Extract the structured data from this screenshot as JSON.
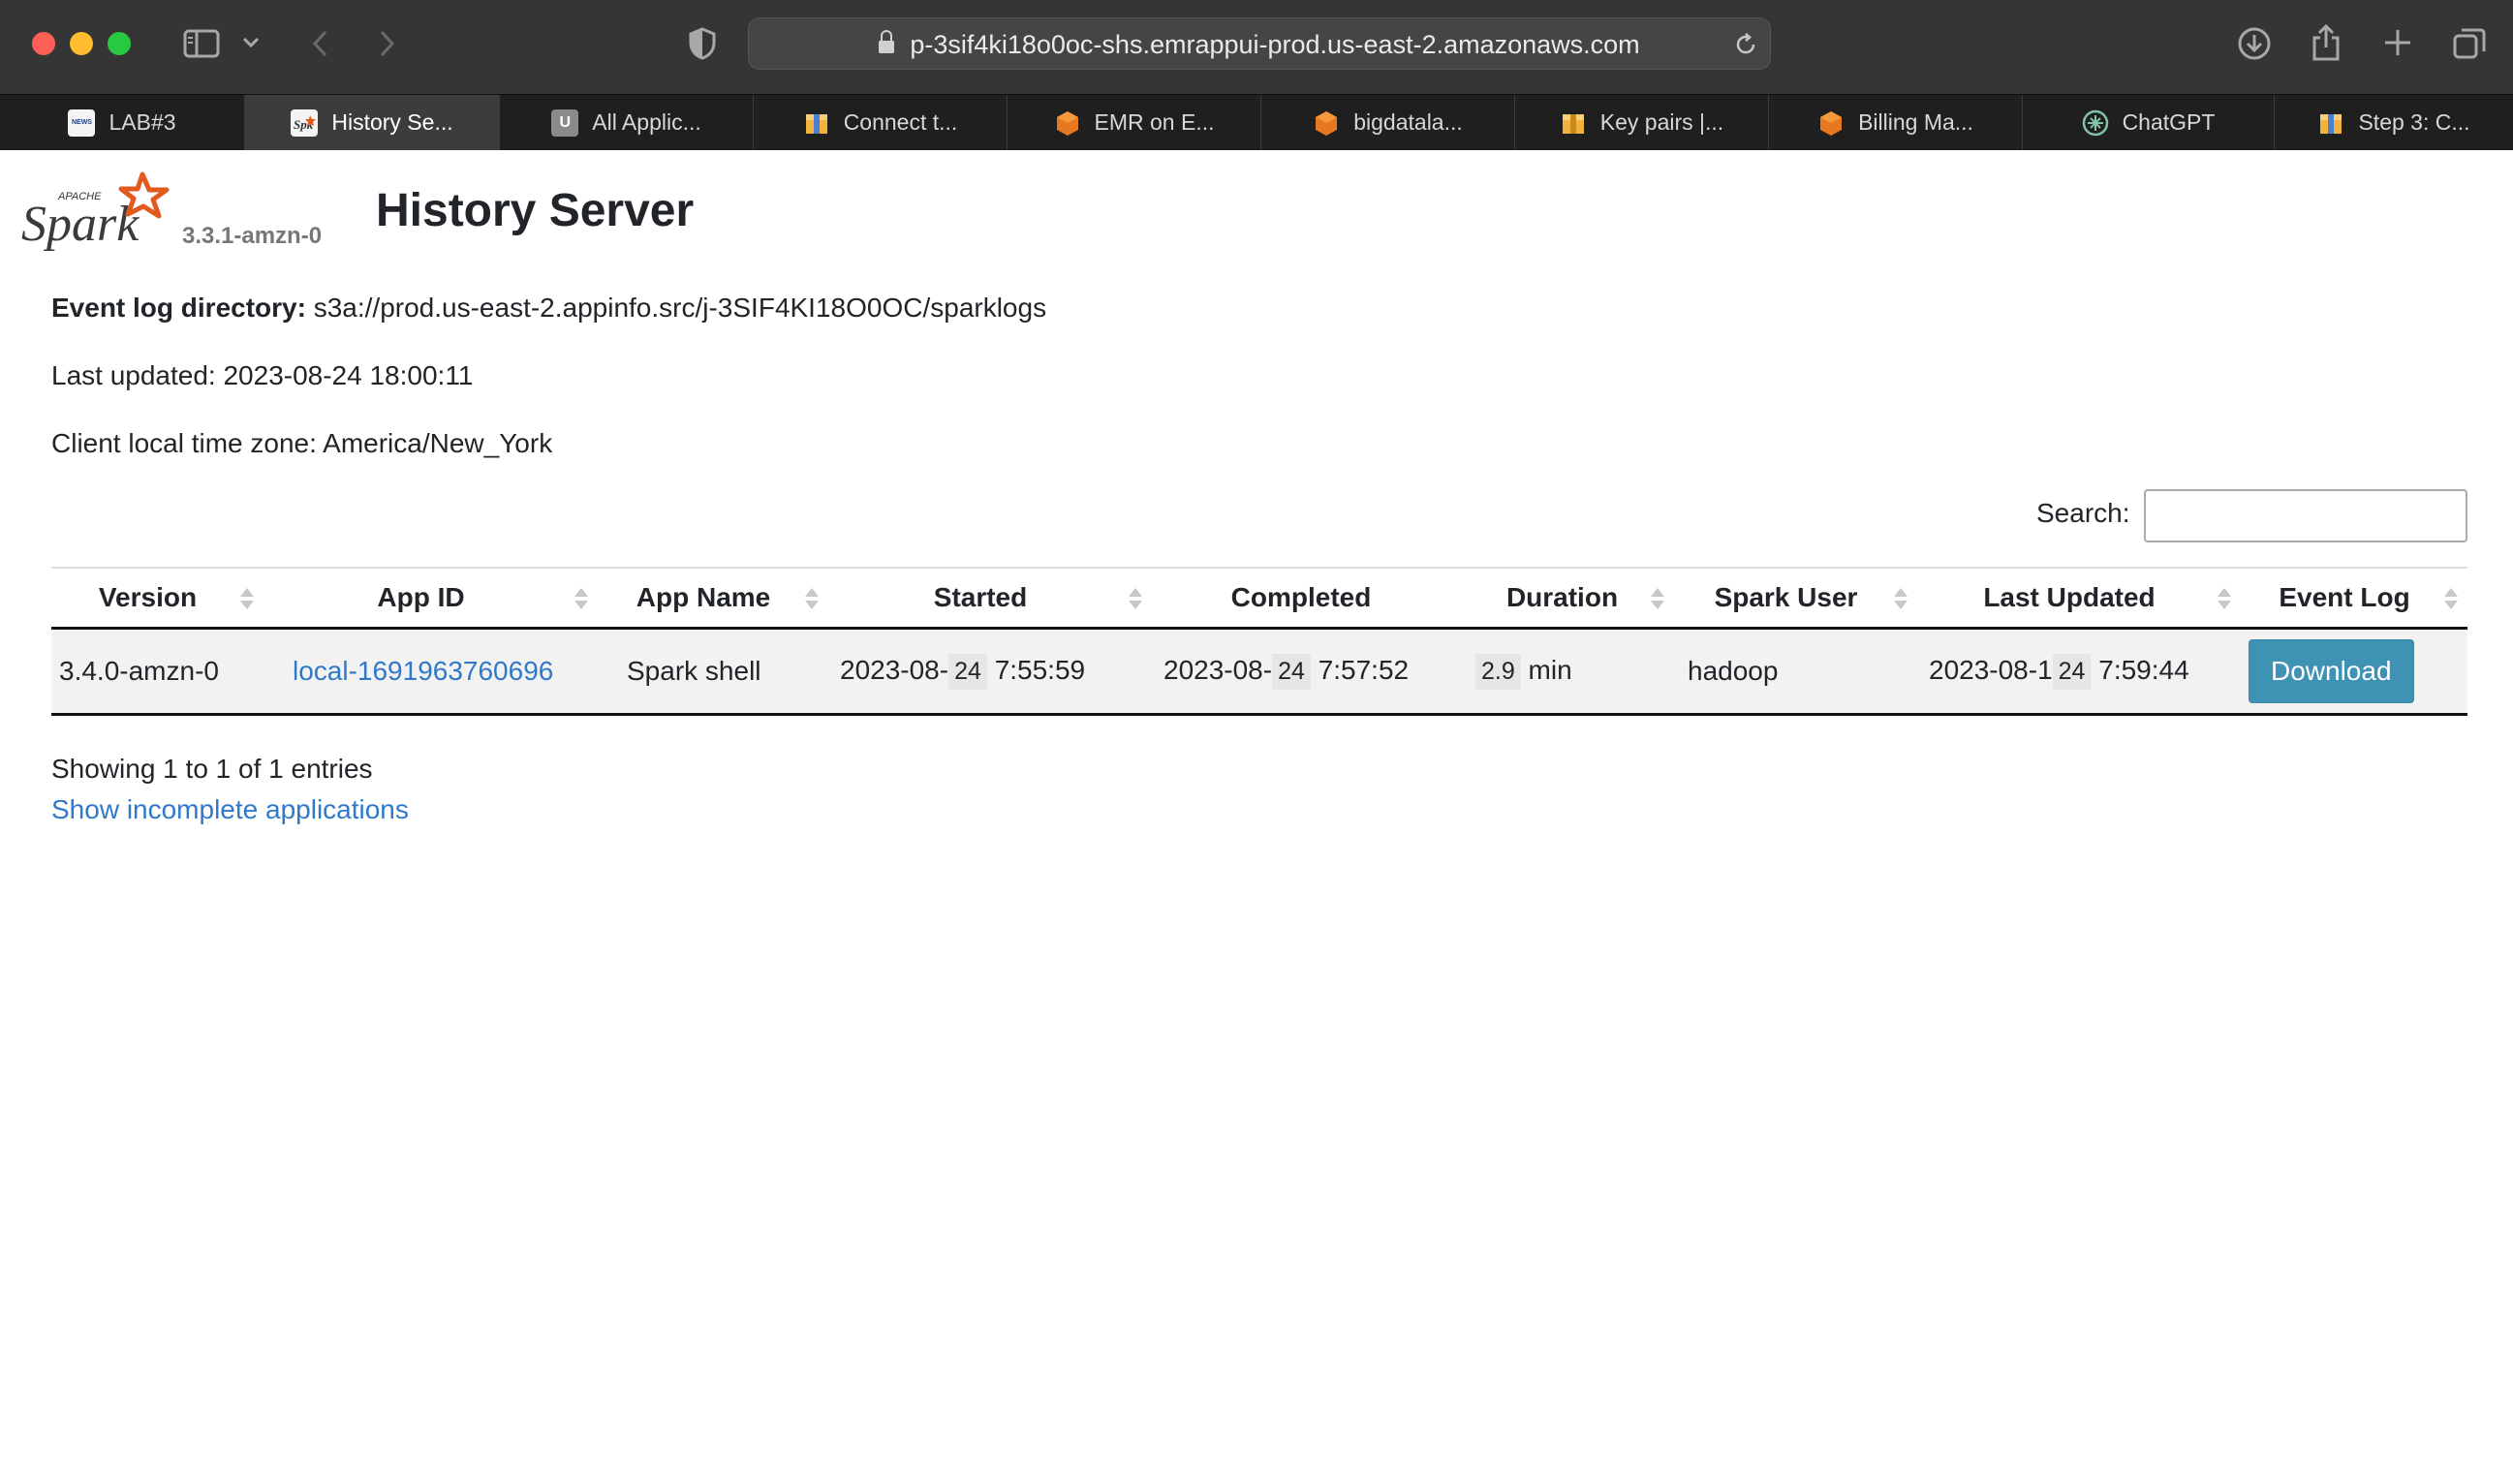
{
  "browser": {
    "url": "p-3sif4ki18o0oc-shs.emrappui-prod.us-east-2.amazonaws.com",
    "tabs": [
      {
        "label": "LAB#3",
        "active": false,
        "icon": "news-favicon"
      },
      {
        "label": "History Se...",
        "active": true,
        "icon": "spark-favicon"
      },
      {
        "label": "All Applic...",
        "active": false,
        "icon": "u-favicon"
      },
      {
        "label": "Connect t...",
        "active": false,
        "icon": "aws-box-favicon"
      },
      {
        "label": "EMR on E...",
        "active": false,
        "icon": "aws-cube-favicon"
      },
      {
        "label": "bigdatala...",
        "active": false,
        "icon": "aws-cube-favicon"
      },
      {
        "label": "Key pairs |...",
        "active": false,
        "icon": "aws-box-favicon"
      },
      {
        "label": "Billing Ma...",
        "active": false,
        "icon": "aws-cube-favicon"
      },
      {
        "label": "ChatGPT",
        "active": false,
        "icon": "chatgpt-favicon"
      },
      {
        "label": "Step 3: C...",
        "active": false,
        "icon": "aws-box-favicon"
      }
    ],
    "favicon_u": "U",
    "favicon_news": "NEWS"
  },
  "header": {
    "logo_text": "Spark",
    "logo_apache": "APACHE",
    "version": "3.3.1-amzn-0",
    "title": "History Server"
  },
  "info": {
    "event_log_label": "Event log directory:",
    "event_log_value": "s3a://prod.us-east-2.appinfo.src/j-3SIF4KI18O0OC/sparklogs",
    "last_updated": "Last updated: 2023-08-24 18:00:11",
    "timezone": "Client local time zone: America/New_York"
  },
  "search": {
    "label": "Search:",
    "value": "",
    "placeholder": ""
  },
  "table": {
    "headers": [
      "Version",
      "App ID",
      "App Name",
      "Started",
      "Completed",
      "Duration",
      "Spark User",
      "Last Updated",
      "Event Log"
    ],
    "rows": [
      {
        "version": "3.4.0-amzn-0",
        "app_id": "local-1691963760696",
        "app_name": "Spark shell",
        "started_prefix": "2023-08-",
        "started_day": "24",
        "started_time": "7:55:59",
        "completed_prefix": "2023-08-",
        "completed_day": "24",
        "completed_time": "7:57:52",
        "duration_value": "2.9",
        "duration_unit": "min",
        "spark_user": "hadoop",
        "updated_prefix": "2023-08-1",
        "updated_day": "24",
        "updated_time": "7:59:44",
        "event_log_button": "Download"
      }
    ]
  },
  "footer": {
    "entries": "Showing 1 to 1 of 1 entries",
    "show_incomplete": "Show incomplete applications"
  },
  "colors": {
    "link": "#2f79c8",
    "download_button": "#3e93b5",
    "spark_orange": "#e25a1c"
  }
}
